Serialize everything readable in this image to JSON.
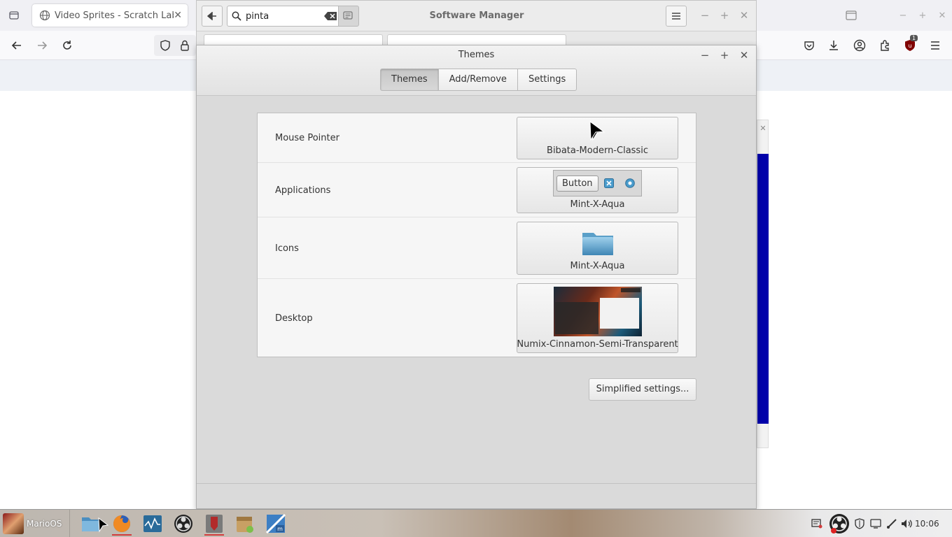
{
  "firefox": {
    "tab_title": "Video Sprites - Scratch Lab",
    "icons": [
      "tab-overview-icon",
      "globe-icon",
      "close-icon",
      "back-icon",
      "forward-icon",
      "reload-icon",
      "shield-icon",
      "lock-icon",
      "pocket-icon",
      "download-icon",
      "account-icon",
      "extensions-icon",
      "ublock-icon",
      "hamburger-menu-icon"
    ],
    "ublock_badge": "1"
  },
  "software_manager": {
    "title": "Software Manager",
    "search": {
      "value": "pinta",
      "placeholder": ""
    }
  },
  "themes_dialog": {
    "title": "Themes",
    "tabs": [
      {
        "label": "Themes",
        "active": true
      },
      {
        "label": "Add/Remove",
        "active": false
      },
      {
        "label": "Settings",
        "active": false
      }
    ],
    "rows": [
      {
        "label": "Mouse Pointer",
        "value": "Bibata-Modern-Classic"
      },
      {
        "label": "Applications",
        "value": "Mint-X-Aqua",
        "preview_button": "Button"
      },
      {
        "label": "Icons",
        "value": "Mint-X-Aqua"
      },
      {
        "label": "Desktop",
        "value": "Numix-Cinnamon-Semi-Transparent"
      }
    ],
    "simplified_button": "Simplified settings..."
  },
  "taskbar": {
    "start_label": "MarioOS",
    "apps": [
      "files",
      "firefox",
      "system-monitor",
      "obs-studio",
      "mate-terminal",
      "package-installer",
      "mintinstall"
    ],
    "clock": "10:06"
  },
  "colors": {
    "accent": "#4a9ccc",
    "scratch_blue": "#0000aa",
    "running_indicator": "#d23b3b"
  }
}
